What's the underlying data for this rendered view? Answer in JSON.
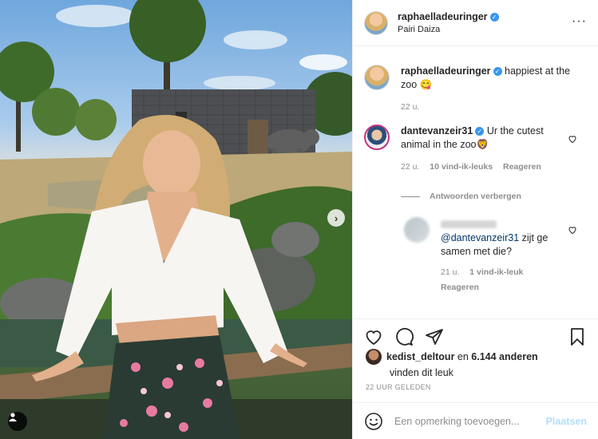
{
  "post": {
    "username": "raphaelladeuringer",
    "location": "Pairi Daiza"
  },
  "caption": {
    "username": "raphaelladeuringer",
    "text": "happiest at the zoo 😋",
    "time": "22 u."
  },
  "comments": [
    {
      "username": "dantevanzeir31",
      "text": "Ur the cutest animal in the zoo🦁",
      "time": "22 u.",
      "likes": "10 vind-ik-leuks",
      "reply_label": "Reageren"
    }
  ],
  "replies_toggle": "Antwoorden verbergen",
  "reply": {
    "mention": "@dantevanzeir31",
    "text": " zijt ge samen met die?",
    "time": "21 u.",
    "likes": "1 vind-ik-leuk",
    "reply_label": "Reageren"
  },
  "likes": {
    "liker": "kedist_deltour",
    "connector": " en ",
    "others": "6.144 anderen",
    "suffix": "vinden dit leuk"
  },
  "timestamp": "22 UUR GELEDEN",
  "add_comment": {
    "placeholder": "Een opmerking toevoegen...",
    "post_label": "Plaatsen"
  },
  "colors": {
    "verified": "#3897f0",
    "post_disabled": "#b2dffc",
    "meta_gray": "#8e8e8e"
  }
}
